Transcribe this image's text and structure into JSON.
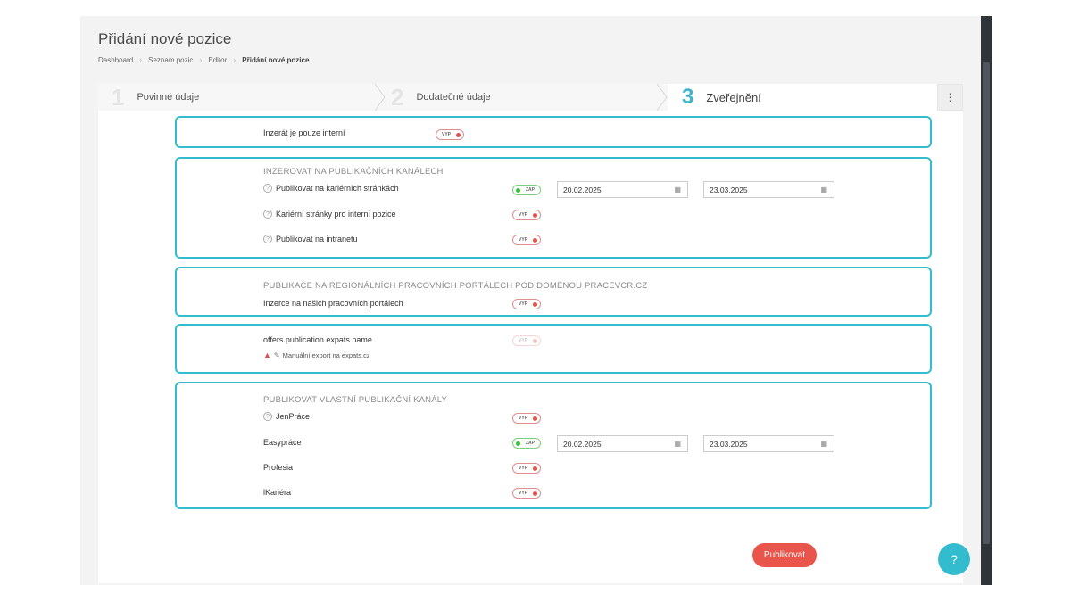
{
  "page": {
    "title": "Přidání nové pozice",
    "breadcrumb": [
      "Dashboard",
      "Seznam pozic",
      "Editor",
      "Přidání nové pozice"
    ]
  },
  "steps": [
    {
      "num": "1",
      "label": "Povinné údaje"
    },
    {
      "num": "2",
      "label": "Dodatečné údaje"
    },
    {
      "num": "3",
      "label": "Zveřejnění"
    }
  ],
  "kebab_icon": "kebab-icon",
  "toggles": {
    "off": "VYP",
    "on": "ZAP"
  },
  "boxes": {
    "internal": {
      "label": "Inzerát je pouze interní"
    },
    "channels": {
      "title": "INZEROVAT NA PUBLIKAČNÍCH KANÁLECH",
      "items": [
        {
          "label": "Publikovat na kariérních stránkách",
          "from": "20.02.2025",
          "to": "23.03.2025"
        },
        {
          "label": "Kariérní stránky pro interní pozice"
        },
        {
          "label": "Publikovat na intranetu"
        }
      ]
    },
    "regional": {
      "title": "PUBLIKACE NA REGIONÁLNÍCH PRACOVNÍCH PORTÁLECH POD DOMÉNOU PRACEVCR.CZ",
      "item": "Inzerce na našich pracovních portálech"
    },
    "expats": {
      "label": "offers.publication.expats.name",
      "note": "Manuální export na expats.cz"
    },
    "own": {
      "title": "PUBLIKOVAT VLASTNÍ PUBLIKAČNÍ KANÁLY",
      "items": [
        {
          "label": "JenPráce"
        },
        {
          "label": "Easypráce",
          "from": "20.02.2025",
          "to": "23.03.2025"
        },
        {
          "label": "Profesia"
        },
        {
          "label": "lKariéra"
        }
      ]
    }
  },
  "actions": {
    "publish": "Publikovat",
    "help": "?"
  },
  "colors": {
    "accent": "#33bccd",
    "publish": "#e9554a",
    "toggle_off": "#e05050",
    "toggle_on": "#3cc13c"
  }
}
